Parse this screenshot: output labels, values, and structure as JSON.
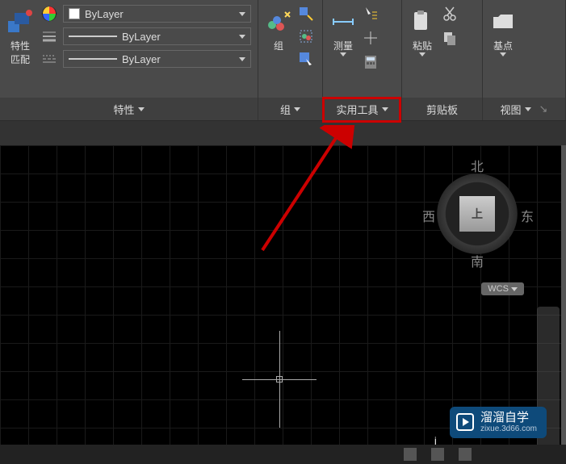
{
  "ribbon": {
    "panels": {
      "properties": {
        "match_props_label": "特性\n匹配",
        "layer_color": "ByLayer",
        "linetype": "ByLayer",
        "lineweight": "ByLayer",
        "footer": "特性"
      },
      "group": {
        "group_label": "组",
        "footer": "组"
      },
      "utilities": {
        "measure_label": "测量",
        "footer": "实用工具"
      },
      "clipboard": {
        "paste_label": "粘贴",
        "footer": "剪贴板"
      },
      "view": {
        "base_label": "基点",
        "footer": "视图"
      }
    }
  },
  "viewcube": {
    "north": "北",
    "south": "南",
    "east": "东",
    "west": "西",
    "top": "上",
    "coord_system": "WCS"
  },
  "cursor_char": "j",
  "watermark": {
    "title": "溜溜自学",
    "url": "zixue.3d66.com"
  },
  "colors": {
    "accent_red": "#cc0000"
  }
}
